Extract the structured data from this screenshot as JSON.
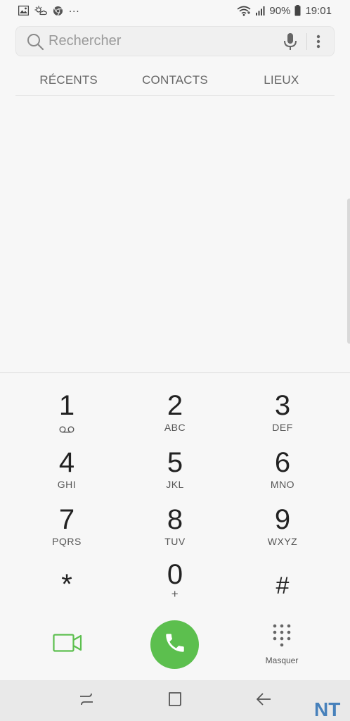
{
  "status_bar": {
    "more_notifications": "...",
    "battery": "90%",
    "time": "19:01"
  },
  "search": {
    "placeholder": "Rechercher"
  },
  "tabs": [
    {
      "label": "RÉCENTS"
    },
    {
      "label": "CONTACTS"
    },
    {
      "label": "LIEUX"
    }
  ],
  "keypad": {
    "keys": [
      {
        "digit": "1",
        "letters": ""
      },
      {
        "digit": "2",
        "letters": "ABC"
      },
      {
        "digit": "3",
        "letters": "DEF"
      },
      {
        "digit": "4",
        "letters": "GHI"
      },
      {
        "digit": "5",
        "letters": "JKL"
      },
      {
        "digit": "6",
        "letters": "MNO"
      },
      {
        "digit": "7",
        "letters": "PQRS"
      },
      {
        "digit": "8",
        "letters": "TUV"
      },
      {
        "digit": "9",
        "letters": "WXYZ"
      },
      {
        "digit": "*",
        "letters": ""
      },
      {
        "digit": "0",
        "letters": "+"
      },
      {
        "digit": "#",
        "letters": ""
      }
    ]
  },
  "actions": {
    "hide_label": "Masquer"
  },
  "icons": {
    "gallery": "image-icon",
    "weather": "weather-icon",
    "chrome": "chrome-icon",
    "wifi": "wifi-icon",
    "signal": "signal-icon",
    "battery": "battery-icon",
    "search": "search-icon",
    "mic": "mic-icon",
    "more": "more-vert-icon",
    "voicemail": "voicemail-icon",
    "video_call": "video-call-icon",
    "call": "phone-icon",
    "keypad": "dialpad-icon",
    "recents": "recents-nav-icon",
    "home": "home-nav-icon",
    "back": "back-nav-icon"
  },
  "colors": {
    "call_green": "#5cbf4e",
    "background": "#f7f7f7",
    "nav_bar": "#e9e9e9",
    "watermark": "#2b6fb3"
  },
  "watermark": {
    "text": "NT"
  }
}
